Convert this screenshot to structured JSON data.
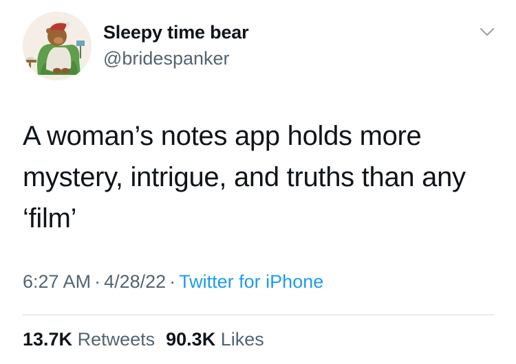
{
  "author": {
    "display_name": "Sleepy time bear",
    "handle": "@bridespanker",
    "avatar_icon": "bear-in-armchair-avatar"
  },
  "tweet": {
    "text": "A woman’s notes app holds more mystery, intrigue, and truths than any ‘film’",
    "time": "6:27 AM",
    "date": "4/28/22",
    "separator": "·",
    "source": "Twitter for iPhone"
  },
  "stats": {
    "retweets_count": "13.7K",
    "retweets_label": "Retweets",
    "likes_count": "90.3K",
    "likes_label": "Likes"
  },
  "colors": {
    "text": "#0f1419",
    "secondary": "#536471",
    "link": "#1d9bf0",
    "divider": "#d9dde0"
  },
  "icons": {
    "menu": "chevron-down-icon"
  }
}
